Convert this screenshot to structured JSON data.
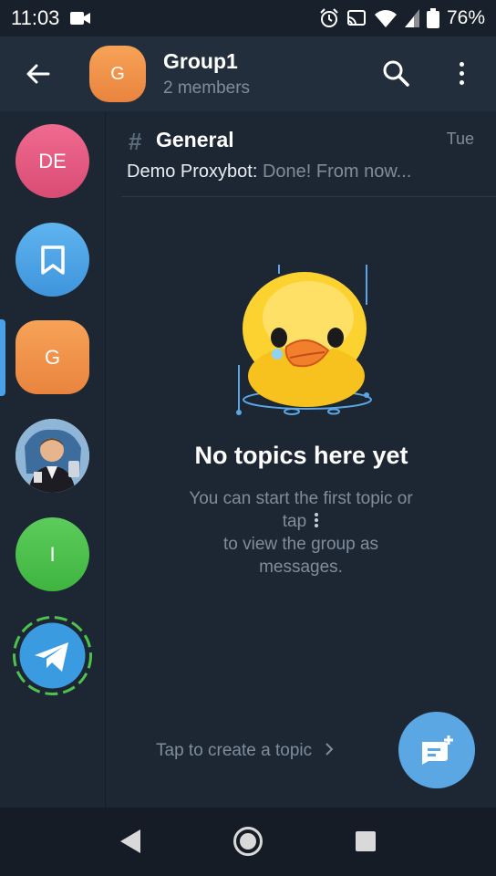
{
  "status_bar": {
    "time": "11:03",
    "battery": "76%"
  },
  "header": {
    "title": "Group1",
    "subtitle": "2 members",
    "avatar_letter": "G"
  },
  "side_rail": [
    {
      "label": "DE",
      "color": "#e35c82"
    },
    {
      "label": "",
      "icon": "bookmark-icon",
      "color": "#4da2e6"
    },
    {
      "label": "G",
      "color": "#f0954b"
    },
    {
      "label": "",
      "icon": "profile-photo",
      "color": "#5c8fbf"
    },
    {
      "label": "I",
      "color": "#4ec14e"
    },
    {
      "label": "",
      "icon": "telegram-icon",
      "color": "#3a9be0"
    }
  ],
  "topic": {
    "name": "General",
    "date": "Tue",
    "sender": "Demo Proxybot:",
    "preview": " Done! From now..."
  },
  "empty_state": {
    "title": "No topics here yet",
    "line1": "You can start the first topic or",
    "line2": "tap",
    "line3": "to view the group as",
    "line4": "messages."
  },
  "create_topic_link": "Tap to create a topic",
  "colors": {
    "accent": "#5aa7e4",
    "background": "#1d2733",
    "header": "#232e3c"
  }
}
